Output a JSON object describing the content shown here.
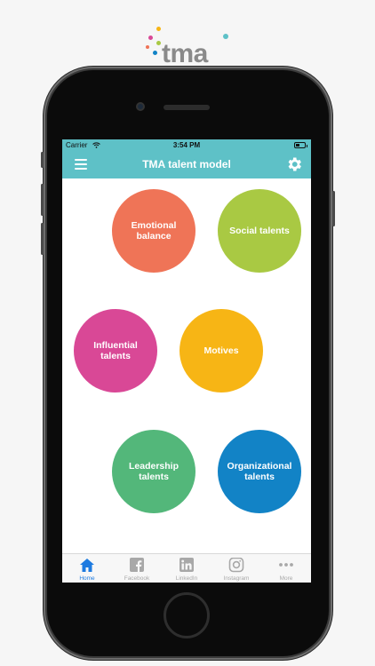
{
  "logo": {
    "text": "tma"
  },
  "status_bar": {
    "carrier": "Carrier",
    "time": "3:54 PM"
  },
  "navbar": {
    "title": "TMA talent model",
    "menu_icon": "hamburger-menu-icon",
    "settings_icon": "gear-icon"
  },
  "talents": [
    {
      "label": "Emotional balance",
      "color": "#ef7457"
    },
    {
      "label": "Social talents",
      "color": "#a9c943"
    },
    {
      "label": "Influential talents",
      "color": "#d94896"
    },
    {
      "label": "Motives",
      "color": "#f7b515"
    },
    {
      "label": "Leadership talents",
      "color": "#53b77a"
    },
    {
      "label": "Organizational talents",
      "color": "#1283c6"
    }
  ],
  "tabs": [
    {
      "label": "Home",
      "icon": "home-icon",
      "active": true
    },
    {
      "label": "Facebook",
      "icon": "facebook-icon",
      "active": false
    },
    {
      "label": "LinkedIn",
      "icon": "linkedin-icon",
      "active": false
    },
    {
      "label": "Instagram",
      "icon": "instagram-icon",
      "active": false
    },
    {
      "label": "More",
      "icon": "more-icon",
      "active": false
    }
  ],
  "colors": {
    "accent": "#5ec1c7",
    "tab_active": "#1e7be0",
    "tab_inactive": "#a8a8a8"
  }
}
